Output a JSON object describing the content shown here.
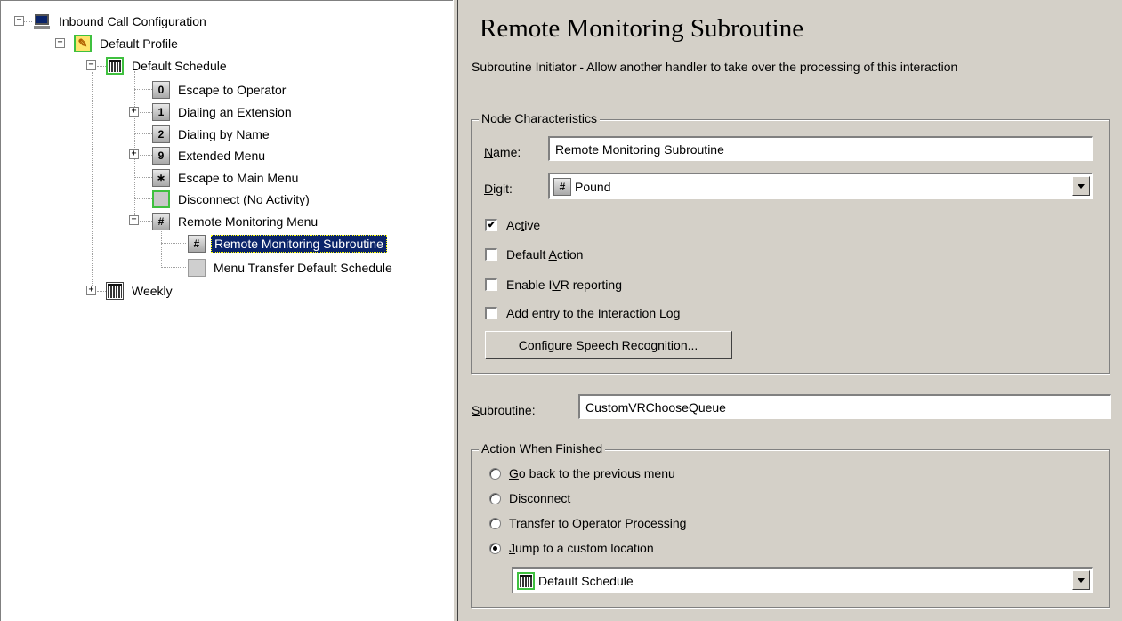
{
  "tree": {
    "root": {
      "label": "Inbound Call  Configuration",
      "icon": "computer-icon",
      "expander": "−"
    },
    "profile": {
      "label": "Default Profile",
      "icon": "profile-icon",
      "expander": "−"
    },
    "schedule": {
      "label": "Default Schedule",
      "icon": "schedule-icon",
      "expander": "−"
    },
    "items": [
      {
        "digit": "0",
        "label": "Escape to Operator"
      },
      {
        "digit": "1",
        "label": "Dialing an Extension",
        "expander": "+"
      },
      {
        "digit": "2",
        "label": "Dialing by Name"
      },
      {
        "digit": "9",
        "label": "Extended Menu",
        "expander": "+"
      },
      {
        "digit": "∗",
        "label": "Escape to Main Menu"
      },
      {
        "digit": "",
        "label": "Disconnect (No Activity)"
      },
      {
        "digit": "#",
        "label": "Remote Monitoring Menu",
        "expander": "−"
      }
    ],
    "sub_items": [
      {
        "digit": "#",
        "label": "Remote Monitoring Subroutine",
        "selected": true
      },
      {
        "digit": "",
        "label": "Menu Transfer Default Schedule"
      }
    ],
    "weekly": {
      "label": "Weekly",
      "expander": "+"
    }
  },
  "panel": {
    "title": "Remote Monitoring Subroutine",
    "description": "Subroutine Initiator - Allow another handler to take over the processing of this interaction",
    "node_characteristics": {
      "group_label": "Node Characteristics",
      "name_label_pre": "",
      "name_label_u": "N",
      "name_label_post": "ame:",
      "name_value": "Remote Monitoring Subroutine",
      "digit_label_pre": "",
      "digit_label_u": "D",
      "digit_label_post": "igit:",
      "digit_symbol": "#",
      "digit_value": "Pound",
      "checkboxes": [
        {
          "pre": "Ac",
          "u": "t",
          "post": "ive",
          "checked": true
        },
        {
          "pre": "Default ",
          "u": "A",
          "post": "ction",
          "checked": false
        },
        {
          "pre": "Enable I",
          "u": "V",
          "post": "R reporting",
          "checked": false
        },
        {
          "pre": "Add entr",
          "u": "y",
          "post": " to the Interaction Log",
          "checked": false
        }
      ],
      "speech_button": "Configure Speech Recognition..."
    },
    "subroutine": {
      "label_u": "S",
      "label_post": "ubroutine:",
      "value": "CustomVRChooseQueue"
    },
    "action_when_finished": {
      "group_label": "Action When Finished",
      "options": [
        {
          "pre": "",
          "u": "G",
          "post": "o back to the previous menu",
          "selected": false
        },
        {
          "pre": "D",
          "u": "i",
          "post": "sconnect",
          "selected": false
        },
        {
          "pre": "Transfer to Operator Processing",
          "u": "",
          "post": "",
          "selected": false
        },
        {
          "pre": "",
          "u": "J",
          "post": "ump to a custom location",
          "selected": true
        }
      ],
      "location_value": "Default Schedule"
    }
  }
}
